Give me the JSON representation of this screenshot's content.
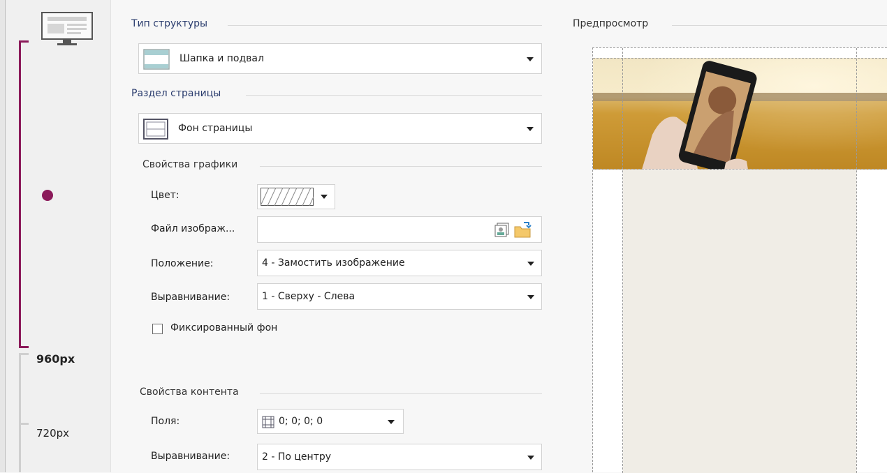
{
  "sidebar": {
    "breakpoints": [
      {
        "label": "960px",
        "active": true
      },
      {
        "label": "720px",
        "active": false
      }
    ],
    "accent_color": "#8b1a5a"
  },
  "structure": {
    "section_title": "Тип структуры",
    "value": "Шапка и подвал"
  },
  "page_section": {
    "section_title": "Раздел страницы",
    "value": "Фон страницы"
  },
  "graphics": {
    "section_title": "Свойства графики",
    "color_label": "Цвет:",
    "file_label": "Файл изображ...",
    "file_value": "",
    "position_label": "Положение:",
    "position_value": "4 - Замостить изображение",
    "alignment_label": "Выравнивание:",
    "alignment_value": "1 - Сверху - Слева",
    "fixed_bg_label": "Фиксированный фон",
    "fixed_bg_checked": false
  },
  "content": {
    "section_title": "Свойства контента",
    "margins_label": "Поля:",
    "margins_value": "0; 0; 0; 0",
    "alignment_label": "Выравнивание:",
    "alignment_value": "2 - По центру"
  },
  "preview": {
    "title": "Предпросмотр",
    "content_bg": "#f0ede6"
  }
}
